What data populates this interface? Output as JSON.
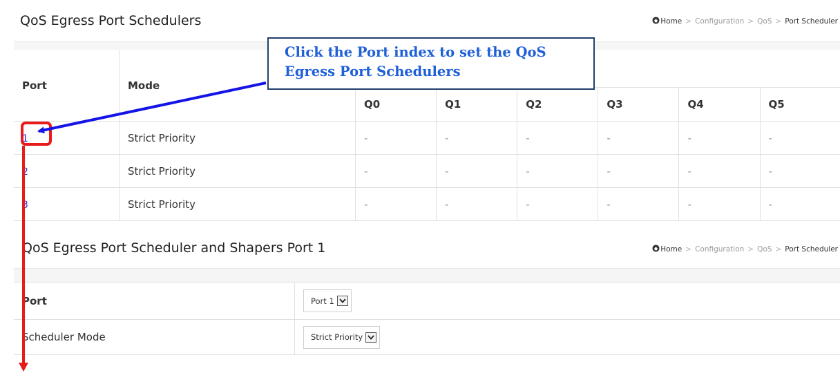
{
  "page1": {
    "title": "QoS Egress Port Schedulers",
    "breadcrumb": [
      "Home",
      "Configuration",
      "QoS",
      "Port Scheduler"
    ],
    "table": {
      "headers": {
        "port": "Port",
        "mode": "Mode"
      },
      "queues": [
        "Q0",
        "Q1",
        "Q2",
        "Q3",
        "Q4",
        "Q5"
      ],
      "rows": [
        {
          "port": "1",
          "mode": "Strict Priority",
          "weights": [
            "-",
            "-",
            "-",
            "-",
            "-",
            "-"
          ]
        },
        {
          "port": "2",
          "mode": "Strict Priority",
          "weights": [
            "-",
            "-",
            "-",
            "-",
            "-",
            "-"
          ]
        },
        {
          "port": "3",
          "mode": "Strict Priority",
          "weights": [
            "-",
            "-",
            "-",
            "-",
            "-",
            "-"
          ]
        }
      ]
    }
  },
  "callout": {
    "line1": "Click the Port index to set the QoS",
    "line2": "Egress Port Schedulers"
  },
  "page2": {
    "title": "QoS Egress Port Scheduler and Shapers  Port 1",
    "breadcrumb": [
      "Home",
      "Configuration",
      "QoS",
      "Port Scheduler"
    ],
    "port_label": "Port",
    "port_value": "Port 1",
    "scheduler_label": "Scheduler Mode",
    "scheduler_value": "Strict Priority"
  },
  "colors": {
    "link": "#2a2ad6",
    "callout_text": "#1f5fd8",
    "callout_border": "#1f3f6e",
    "arrow_blue": "#1414e6",
    "highlight_red": "#e81a1a"
  }
}
